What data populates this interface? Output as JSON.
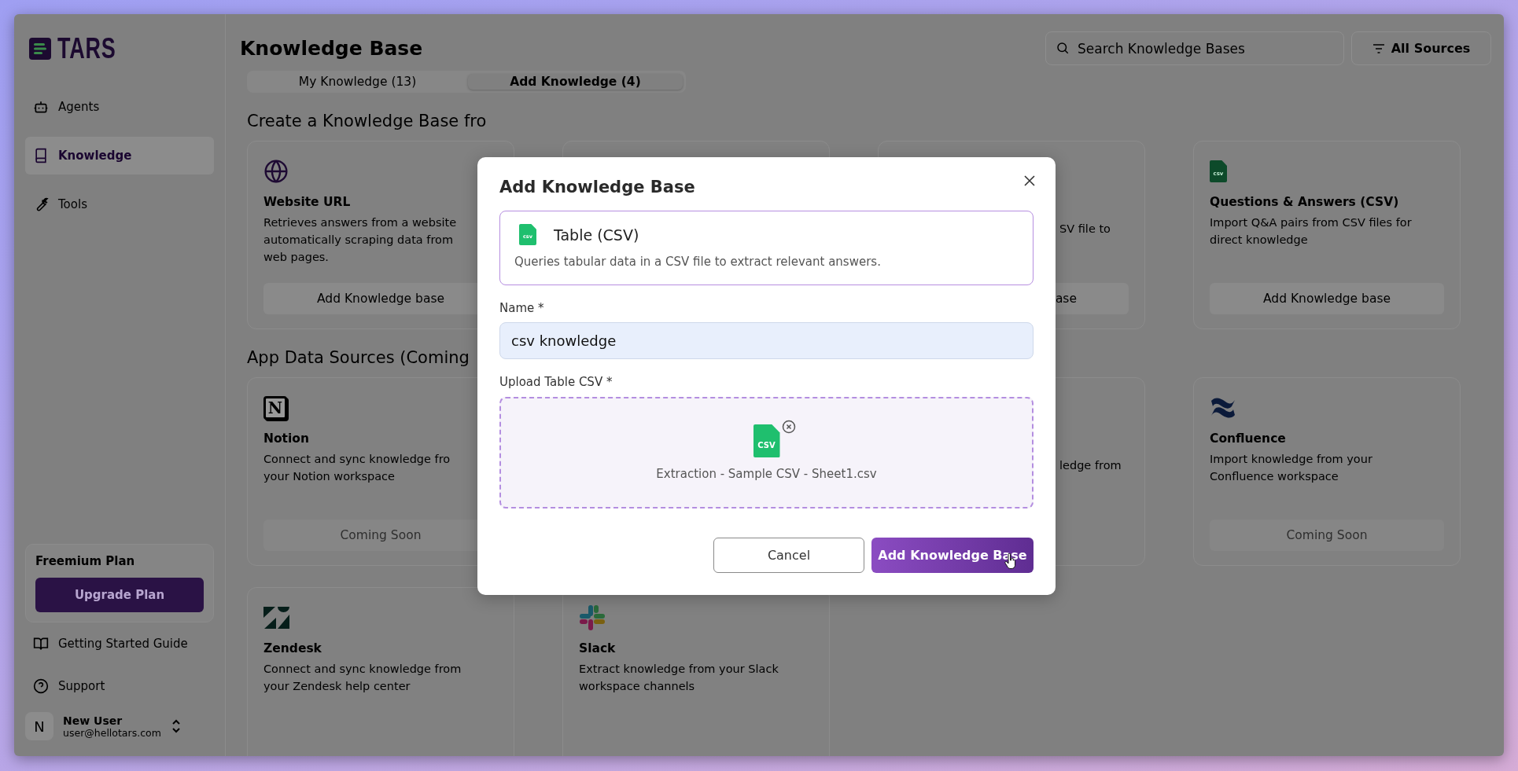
{
  "sidebar": {
    "logo": "TARS",
    "nav": [
      {
        "label": "Agents",
        "selected": false
      },
      {
        "label": "Knowledge",
        "selected": true
      },
      {
        "label": "Tools",
        "selected": false
      }
    ],
    "plan": {
      "title": "Freemium Plan",
      "button": "Upgrade Plan"
    },
    "links": [
      "Getting Started Guide",
      "Support"
    ],
    "user": {
      "initial": "N",
      "name": "New User",
      "email": "user@hellotars.com"
    }
  },
  "header": {
    "title": "Knowledge Base",
    "search": {
      "placeholder": "Search Knowledge Bases"
    },
    "filter": "All Sources"
  },
  "tabs": [
    {
      "label": "My Knowledge (13)",
      "selected": false
    },
    {
      "label": "Add Knowledge (4)",
      "selected": true
    }
  ],
  "sections": [
    {
      "heading": "Create a Knowledge Base fro",
      "cards": [
        {
          "kind": "full",
          "title": "Website URL",
          "lines": [
            "Retrieves answers from a website",
            "automatically scraping data from",
            "web pages."
          ],
          "button": {
            "label": "Add Knowledge base",
            "disabled": false
          }
        },
        {
          "kind": "covered"
        },
        {
          "kind": "partial",
          "lines": [
            "SV file to"
          ],
          "button": {
            "label": "ase",
            "disabled": false
          }
        },
        {
          "kind": "full",
          "icon_label": "csv",
          "title": "Questions & Answers (CSV)",
          "lines": [
            "Import Q&A pairs from CSV files for",
            "direct knowledge"
          ],
          "button": {
            "label": "Add Knowledge base",
            "disabled": false
          }
        }
      ]
    },
    {
      "heading": "App Data Sources (Coming",
      "cards": [
        {
          "kind": "full",
          "icon_label": "N",
          "title": "Notion",
          "lines": [
            "Connect and sync knowledge fro",
            "your Notion workspace"
          ],
          "button": {
            "label": "Coming Soon",
            "disabled": true
          }
        },
        {
          "kind": "covered"
        },
        {
          "kind": "partial",
          "lines": [
            "ledge from"
          ]
        },
        {
          "kind": "full",
          "title": "Confluence",
          "lines": [
            "Import knowledge from your",
            "Confluence workspace"
          ],
          "button": {
            "label": "Coming Soon",
            "disabled": true
          }
        },
        {
          "kind": "full",
          "title": "Zendesk",
          "lines": [
            "Connect and sync knowledge from",
            "your Zendesk help center"
          ]
        },
        {
          "kind": "full",
          "title": "Slack",
          "lines": [
            "Extract knowledge from your Slack",
            "workspace channels"
          ]
        }
      ]
    }
  ],
  "modal": {
    "title": "Add Knowledge Base",
    "type_card": {
      "icon_label": "csv",
      "title": "Table (CSV)",
      "description": "Queries tabular data in a CSV file to extract relevant answers."
    },
    "name_field": {
      "label": "Name *",
      "value": "csv knowledge"
    },
    "upload": {
      "label": "Upload Table CSV *",
      "icon_label": "CSV",
      "file_name": "Extraction - Sample CSV - Sheet1.csv"
    },
    "buttons": [
      {
        "label": "Cancel",
        "kind": "secondary"
      },
      {
        "label": "Add Knowledge Base",
        "kind": "primary"
      }
    ]
  }
}
